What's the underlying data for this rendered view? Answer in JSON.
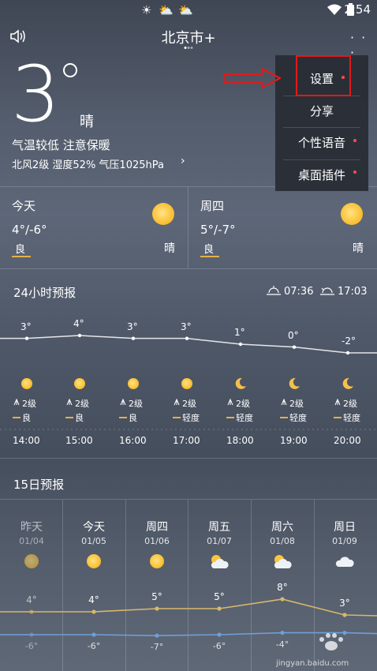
{
  "status_bar": {
    "time": "2:54",
    "icons": [
      "sun-icon",
      "cloud-sun-icon",
      "cloud-sun-icon",
      "wifi-icon",
      "battery-icon"
    ]
  },
  "header": {
    "city": "北京市",
    "add_symbol": "+",
    "more_symbol": "· · ·"
  },
  "current": {
    "temperature": "3",
    "condition": "晴",
    "tip": "气温较低 注意保暖",
    "details": "北风2级  湿度52%  气压1025hPa",
    "details_arrow": "›"
  },
  "days": [
    {
      "name": "今天",
      "temp": "4°/-6°",
      "aqi": "良",
      "condition": "晴"
    },
    {
      "name": "周四",
      "temp": "5°/-7°",
      "aqi": "良",
      "condition": "晴"
    }
  ],
  "hourly": {
    "title": "24小时预报",
    "sunrise": "07:36",
    "sunset": "17:03",
    "items": [
      {
        "temp": "3°",
        "value": 3,
        "icon": "sun-icon",
        "wind": "2级",
        "aqi": "良",
        "time": "14:00"
      },
      {
        "temp": "4°",
        "value": 4,
        "icon": "sun-icon",
        "wind": "2级",
        "aqi": "良",
        "time": "15:00"
      },
      {
        "temp": "3°",
        "value": 3,
        "icon": "sun-icon",
        "wind": "2级",
        "aqi": "良",
        "time": "16:00"
      },
      {
        "temp": "3°",
        "value": 3,
        "icon": "sun-icon",
        "wind": "2级",
        "aqi": "轻度",
        "time": "17:00"
      },
      {
        "temp": "1°",
        "value": 1,
        "icon": "moon-icon",
        "wind": "2级",
        "aqi": "轻度",
        "time": "18:00"
      },
      {
        "temp": "0°",
        "value": 0,
        "icon": "moon-icon",
        "wind": "2级",
        "aqi": "轻度",
        "time": "19:00"
      },
      {
        "temp": "-2°",
        "value": -2,
        "icon": "moon-icon",
        "wind": "2级",
        "aqi": "轻度",
        "time": "20:00"
      }
    ]
  },
  "daily": {
    "title": "15日预报",
    "items": [
      {
        "name": "昨天",
        "date": "01/04",
        "icon": "sun-icon",
        "hi": "4°",
        "hi_value": 4,
        "lo": "-6°",
        "lo_value": -6
      },
      {
        "name": "今天",
        "date": "01/05",
        "icon": "sun-icon",
        "hi": "4°",
        "hi_value": 4,
        "lo": "-6°",
        "lo_value": -6
      },
      {
        "name": "周四",
        "date": "01/06",
        "icon": "sun-icon",
        "hi": "5°",
        "hi_value": 5,
        "lo": "-7°",
        "lo_value": -7
      },
      {
        "name": "周五",
        "date": "01/07",
        "icon": "partly-cloudy-icon",
        "hi": "5°",
        "hi_value": 5,
        "lo": "-6°",
        "lo_value": -6
      },
      {
        "name": "周六",
        "date": "01/08",
        "icon": "partly-cloudy-icon",
        "hi": "8°",
        "hi_value": 8,
        "lo": "-4°",
        "lo_value": -4
      },
      {
        "name": "周日",
        "date": "01/09",
        "icon": "cloud-icon",
        "hi": "3°",
        "hi_value": 3,
        "lo": "",
        "lo_value": -4
      }
    ]
  },
  "menu": {
    "items": [
      {
        "label": "设置",
        "dot": true
      },
      {
        "label": "分享",
        "dot": false
      },
      {
        "label": "个性语音",
        "dot": true
      },
      {
        "label": "桌面插件",
        "dot": true
      }
    ]
  },
  "watermark": {
    "text": "jingyan.baidu.com"
  },
  "colors": {
    "sun": "#fbc43a",
    "aqi_line": "#e3b14a",
    "high_line": "#d8b86a",
    "low_line": "#6f9fd8",
    "highlight": "#e01a1a",
    "menu_dot": "#ff4b4b"
  }
}
